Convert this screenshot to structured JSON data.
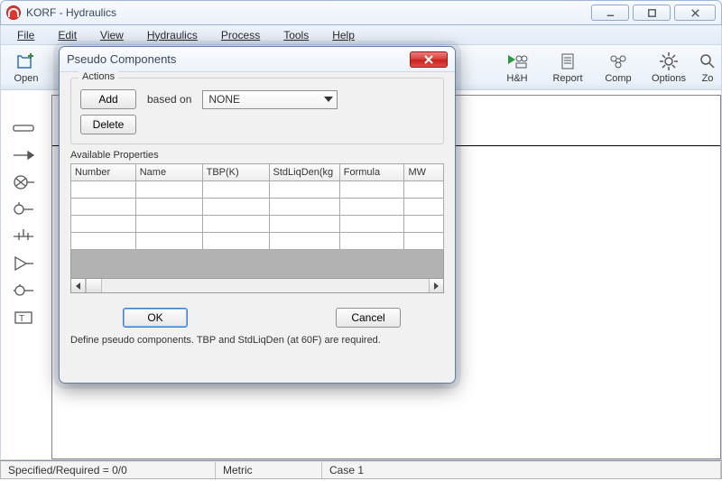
{
  "window": {
    "title": "KORF - Hydraulics"
  },
  "menu": {
    "file": "File",
    "edit": "Edit",
    "view": "View",
    "hydraulics": "Hydraulics",
    "process": "Process",
    "tools": "Tools",
    "help": "Help"
  },
  "toolbar": {
    "open": "Open",
    "hh": "H&H",
    "report": "Report",
    "comp": "Comp",
    "options": "Options",
    "zoom": "Zo"
  },
  "dialog": {
    "title": "Pseudo Components",
    "actions_legend": "Actions",
    "add": "Add",
    "delete": "Delete",
    "based_on": "based on",
    "combo_value": "NONE",
    "available_label": "Available Properties",
    "columns": {
      "number": "Number",
      "name": "Name",
      "tbp": "TBP(K)",
      "stdliq": "StdLiqDen(kg",
      "formula": "Formula",
      "mw": "MW"
    },
    "ok": "OK",
    "cancel": "Cancel",
    "hint": "Define pseudo components. TBP and StdLiqDen (at 60F) are required."
  },
  "status": {
    "spec": "Specified/Required = 0/0",
    "units": "Metric",
    "case": "Case 1"
  }
}
